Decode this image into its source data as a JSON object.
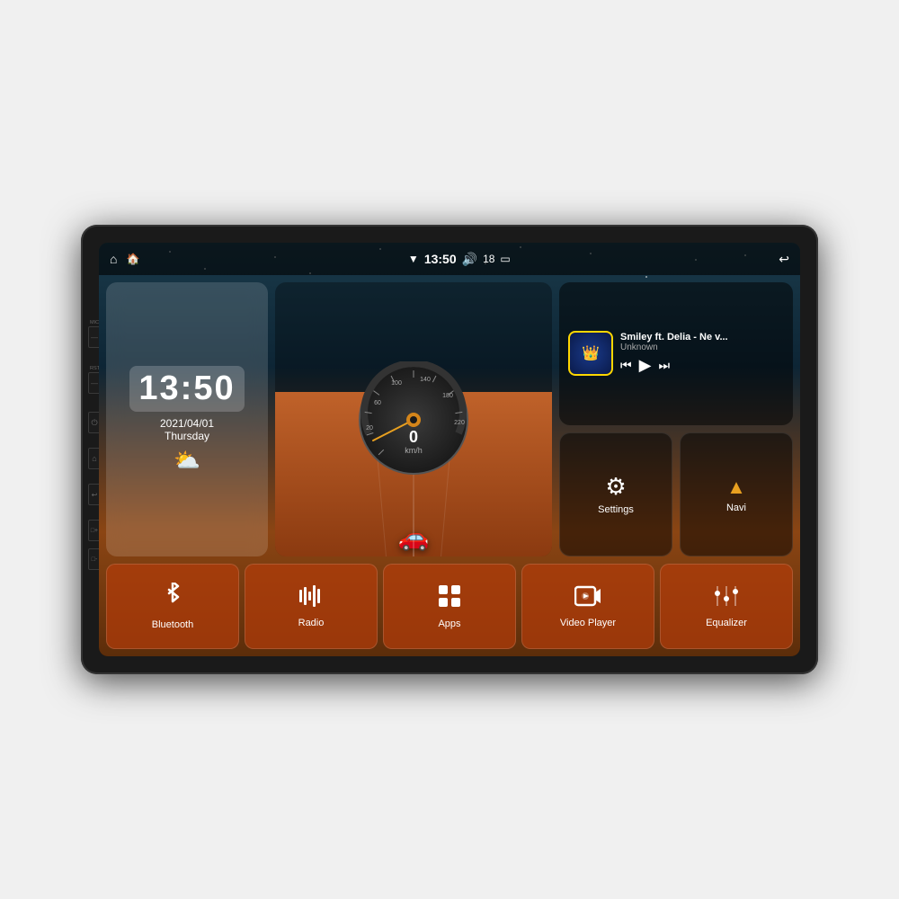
{
  "device": {
    "status_bar": {
      "home_icon": "⌂",
      "android_icon": "🏠",
      "wifi_icon": "▼",
      "time": "13:50",
      "volume_icon": "🔊",
      "volume_level": "18",
      "battery_icon": "▭",
      "back_icon": "↩"
    },
    "clock_widget": {
      "time": "13:50",
      "date": "2021/04/01",
      "day": "Thursday",
      "weather_icon": "⛅"
    },
    "music_widget": {
      "title": "Smiley ft. Delia - Ne v...",
      "artist": "Unknown",
      "album_icon": "👑",
      "prev_icon": "⏮",
      "play_icon": "▶",
      "next_icon": "⏭"
    },
    "right_widgets": [
      {
        "id": "settings",
        "label": "Settings",
        "icon": "⚙"
      },
      {
        "id": "navi",
        "label": "Navi",
        "icon": "△"
      }
    ],
    "bottom_apps": [
      {
        "id": "bluetooth",
        "label": "Bluetooth",
        "icon": "bluetooth"
      },
      {
        "id": "radio",
        "label": "Radio",
        "icon": "radio"
      },
      {
        "id": "apps",
        "label": "Apps",
        "icon": "apps"
      },
      {
        "id": "video-player",
        "label": "Video Player",
        "icon": "video"
      },
      {
        "id": "equalizer",
        "label": "Equalizer",
        "icon": "equalizer"
      }
    ],
    "speedo": {
      "value": "0",
      "unit": "km/h",
      "max": "220"
    },
    "side_buttons": [
      {
        "label": "MIC",
        "icon": ""
      },
      {
        "label": "RST",
        "icon": ""
      },
      {
        "label": "",
        "icon": "⏻"
      },
      {
        "label": "",
        "icon": "⌂"
      },
      {
        "label": "",
        "icon": "↩"
      },
      {
        "label": "",
        "icon": "□+"
      },
      {
        "label": "",
        "icon": "□-"
      }
    ]
  }
}
